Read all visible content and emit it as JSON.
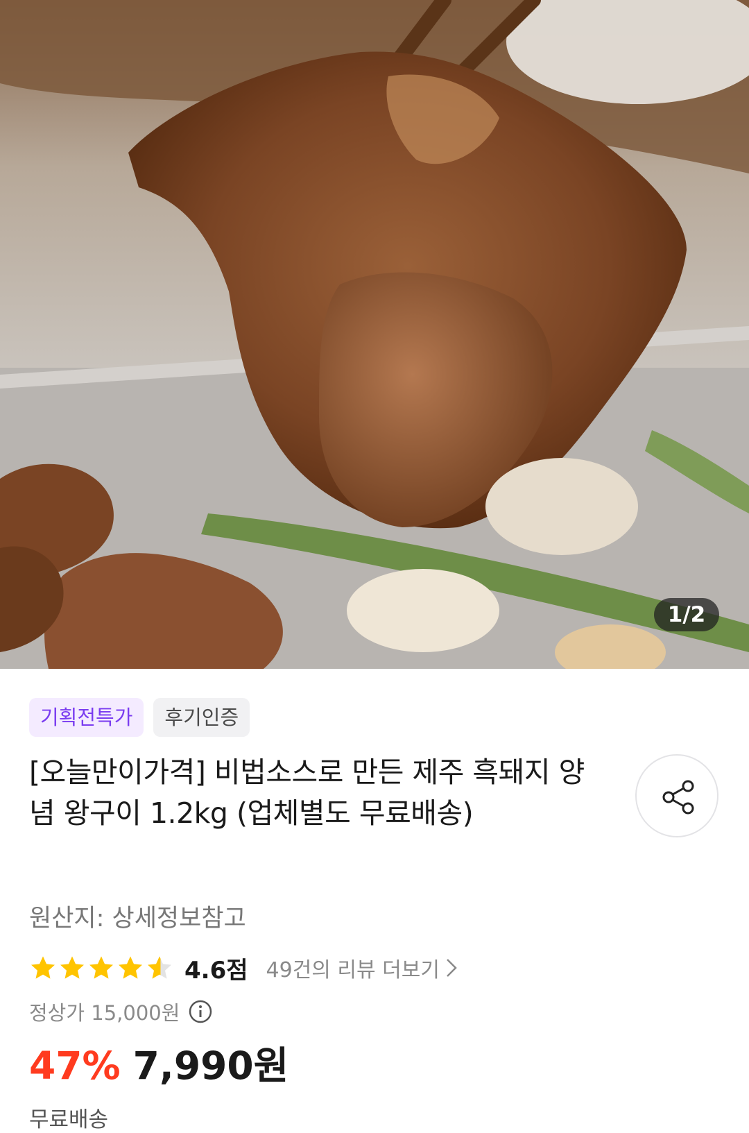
{
  "gallery": {
    "counter": "1/2"
  },
  "badges": {
    "promo": "기획전특가",
    "review": "후기인증"
  },
  "product": {
    "title": "[오늘만이가격] 비법소스로 만든 제주 흑돼지 양념 왕구이 1.2kg (업체별도 무료배송)",
    "origin": "원산지: 상세정보참고"
  },
  "rating": {
    "stars_value": 4.6,
    "score_label": "4.6점",
    "reviews_link": "49건의 리뷰 더보기",
    "star_color": "#ffc400"
  },
  "price": {
    "original": "정상가 15,000원",
    "discount": "47%",
    "sale": "7,990원"
  },
  "shipping": {
    "label": "무료배송"
  },
  "colors": {
    "accent_red": "#ff3b1f",
    "accent_purple": "#7a3cf0"
  }
}
